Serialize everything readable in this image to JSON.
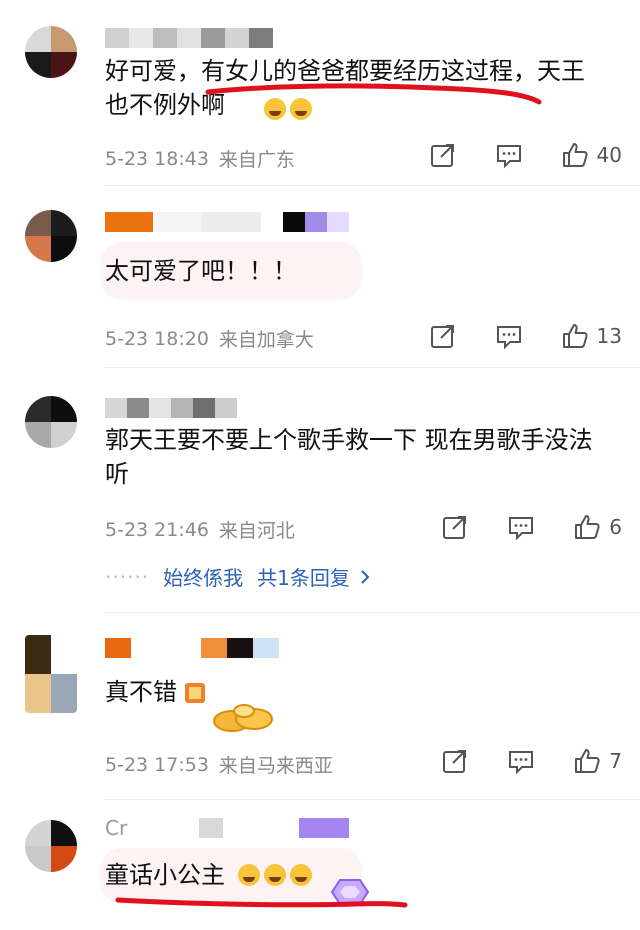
{
  "comments": [
    {
      "text": "好可爱，有女儿的爸爸都要经历这过程，天王也不例外啊",
      "date": "5-23 18:43",
      "location": "来自广东",
      "likes": "40"
    },
    {
      "text": "太可爱了吧！！！",
      "date": "5-23 18:20",
      "location": "来自加拿大",
      "likes": "13"
    },
    {
      "text": "郭天王要不要上个歌手救一下 现在男歌手没法听",
      "date": "5-23 21:46",
      "location": "来自河北",
      "likes": "6",
      "reply_user": "始终係我",
      "reply_count_label": "共1条回复"
    },
    {
      "text": "真不错",
      "date": "5-23 17:53",
      "location": "来自马来西亚",
      "likes": "7"
    },
    {
      "name_partial": "Cr",
      "text": "童话小公主"
    }
  ],
  "colors": {
    "annotation_red": "#e0101f",
    "reply_link": "#2b63b8"
  },
  "icons": [
    "share-icon",
    "comment-icon",
    "thumbs-up-icon",
    "chevron-right-icon"
  ]
}
